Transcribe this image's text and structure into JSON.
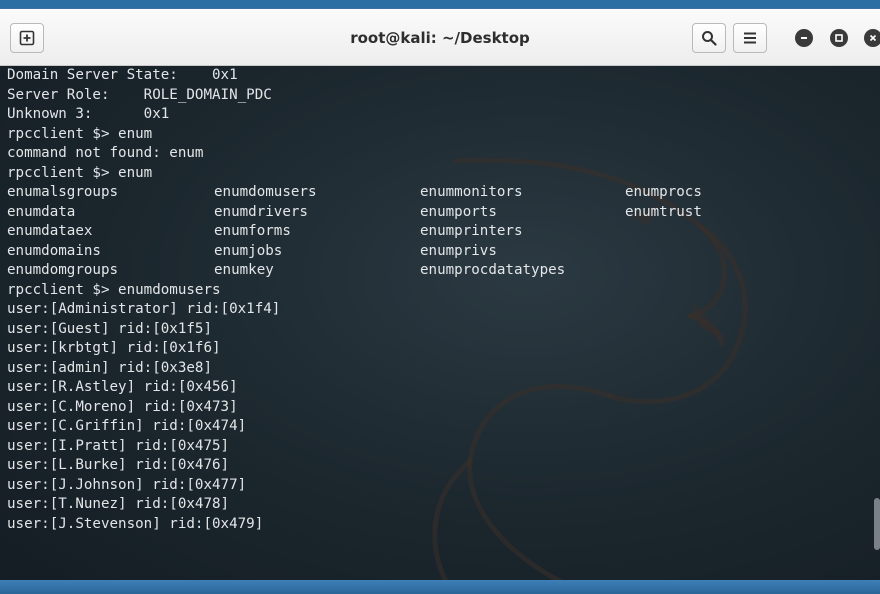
{
  "window": {
    "title": "root@kali: ~/Desktop",
    "buttons": {
      "new_tab_icon": "new-tab-icon",
      "search_icon": "search-icon",
      "menu_icon": "hamburger-menu-icon",
      "minimize_icon": "minimize-icon",
      "maximize_icon": "maximize-icon",
      "close_icon": "close-icon"
    }
  },
  "terminal": {
    "colors": {
      "background": "#1b262d",
      "foreground": "#e3e6e8"
    },
    "header_lines": [
      "Domain Server State:\t0x1",
      "Server Role:\tROLE_DOMAIN_PDC",
      "Unknown 3:\t0x1",
      "rpcclient $> enum",
      "command not found: enum",
      "rpcclient $> enum"
    ],
    "completion_rows": [
      [
        "enumalsgroups",
        "enumdomusers",
        "enummonitors",
        "enumprocs"
      ],
      [
        "enumdata",
        "enumdrivers",
        "enumports",
        "enumtrust"
      ],
      [
        "enumdataex",
        "enumforms",
        "enumprinters",
        ""
      ],
      [
        "enumdomains",
        "enumjobs",
        "enumprivs",
        ""
      ],
      [
        "enumdomgroups",
        "enumkey",
        "enumprocdatatypes",
        ""
      ]
    ],
    "output_lines": [
      "rpcclient $> enumdomusers",
      "user:[Administrator] rid:[0x1f4]",
      "user:[Guest] rid:[0x1f5]",
      "user:[krbtgt] rid:[0x1f6]",
      "user:[admin] rid:[0x3e8]",
      "user:[R.Astley] rid:[0x456]",
      "user:[C.Moreno] rid:[0x473]",
      "user:[C.Griffin] rid:[0x474]",
      "user:[I.Pratt] rid:[0x475]",
      "user:[L.Burke] rid:[0x476]",
      "user:[J.Johnson] rid:[0x477]",
      "user:[T.Nunez] rid:[0x478]",
      "user:[J.Stevenson] rid:[0x479]"
    ]
  }
}
